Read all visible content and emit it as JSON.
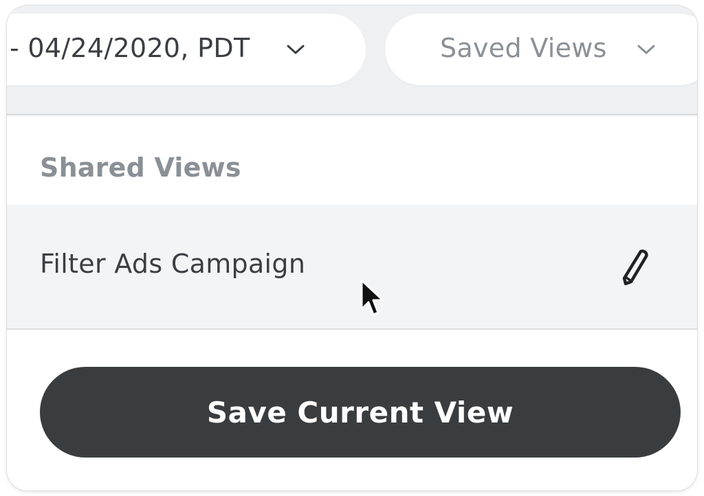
{
  "date_filter": {
    "label": "- 04/24/2020, PDT",
    "icon": "chevron-down-icon"
  },
  "saved_views": {
    "label": "Saved Views",
    "icon": "chevron-down-icon"
  },
  "menu": {
    "section_title": "Shared Views",
    "items": [
      {
        "label": "Filter Ads Campaign",
        "icon": "pencil-icon"
      }
    ],
    "save_button_label": "Save Current View"
  },
  "colors": {
    "toolbar_bg": "#eef0f1",
    "row_hover_bg": "#f3f4f6",
    "button_bg": "#3a3d40",
    "muted_text": "#8a9096",
    "primary_text": "#3b3e42"
  }
}
